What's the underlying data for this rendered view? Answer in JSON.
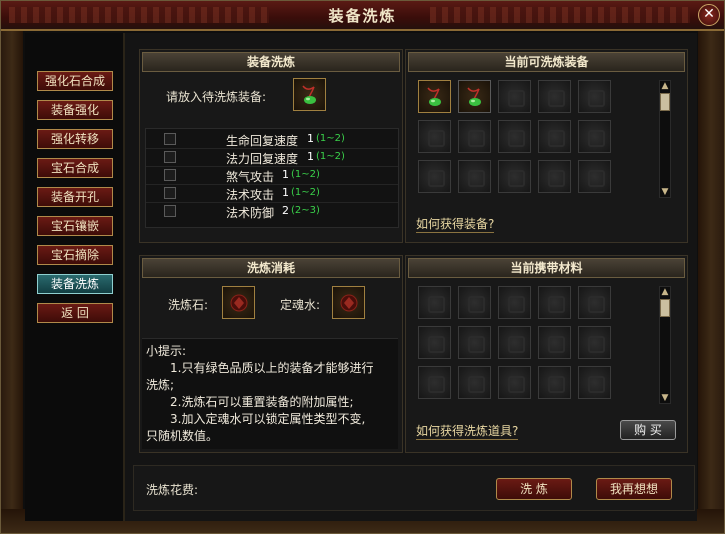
{
  "window": {
    "title": "装备洗炼",
    "close_glyph": "✕"
  },
  "nav": {
    "items": [
      {
        "label": "强化石合成",
        "active": false
      },
      {
        "label": "装备强化",
        "active": false
      },
      {
        "label": "强化转移",
        "active": false
      },
      {
        "label": "宝石合成",
        "active": false
      },
      {
        "label": "装备开孔",
        "active": false
      },
      {
        "label": "宝石镶嵌",
        "active": false
      },
      {
        "label": "宝石摘除",
        "active": false
      },
      {
        "label": "装备洗炼",
        "active": true
      },
      {
        "label": "返  回",
        "active": false
      }
    ]
  },
  "refine_panel": {
    "title": "装备洗炼",
    "prompt": "请放入待洗炼装备:",
    "slot_icon": "green-pendant-icon",
    "attributes": [
      {
        "name": "生命回复速度",
        "value": "1",
        "range": "(1~2)",
        "checked": false
      },
      {
        "name": "法力回复速度",
        "value": "1",
        "range": "(1~2)",
        "checked": false
      },
      {
        "name": "煞气攻击",
        "value": "1",
        "range": "(1~2)",
        "checked": false
      },
      {
        "name": "法术攻击",
        "value": "1",
        "range": "(1~2)",
        "checked": false
      },
      {
        "name": "法术防御",
        "value": "2",
        "range": "(2~3)",
        "checked": false
      }
    ]
  },
  "equip_panel": {
    "title": "当前可洗炼装备",
    "slots": [
      "green-pendant-icon",
      "green-pendant-icon",
      "",
      "",
      "",
      "",
      "",
      "",
      "",
      "",
      "",
      "",
      "",
      "",
      "",
      ""
    ],
    "link": "如何获得装备?"
  },
  "cost_panel": {
    "title": "洗炼消耗",
    "stone_label": "洗炼石:",
    "water_label": "定魂水:",
    "stone_icon": "refining-stone-icon",
    "water_icon": "soul-water-icon"
  },
  "materials_panel": {
    "title": "当前携带材料",
    "link": "如何获得洗炼道具?",
    "buy_label": "购 买"
  },
  "tips": {
    "heading": "小提示:",
    "line1a": "1.只有绿色品质以上的装备才能够进行",
    "line1b": "洗炼;",
    "line2": "2.洗炼石可以重置装备的附加属性;",
    "line3a": "3.加入定魂水可以锁定属性类型不变,",
    "line3b": "只随机数值。"
  },
  "footer": {
    "cost_label": "洗炼花费:",
    "refine_button": "洗 炼",
    "cancel_button": "我再想想"
  },
  "colors": {
    "range_green": "#3ad04a",
    "active_nav": "#2a6a6e",
    "button_red": "#6a1a14"
  }
}
